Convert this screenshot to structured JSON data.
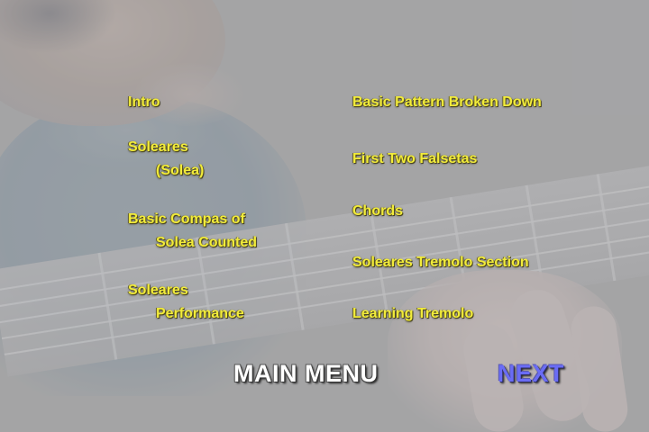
{
  "menu": {
    "left": [
      {
        "lines": [
          "Intro"
        ]
      },
      {
        "lines": [
          "Soleares",
          "(Solea)"
        ]
      },
      {
        "lines": [
          "Basic Compas of",
          "Solea Counted"
        ]
      },
      {
        "lines": [
          "Soleares",
          "Performance"
        ]
      }
    ],
    "right": [
      {
        "lines": [
          "Basic Pattern Broken Down"
        ]
      },
      {
        "lines": [
          "First Two Falsetas"
        ]
      },
      {
        "lines": [
          "Chords"
        ]
      },
      {
        "lines": [
          "Soleares Tremolo Section"
        ]
      },
      {
        "lines": [
          "Learning Tremolo"
        ]
      }
    ]
  },
  "nav": {
    "main_menu_label": "MAIN MENU",
    "next_label": "NEXT"
  },
  "colors": {
    "menu_text": "#f2ec3a",
    "main_menu_text": "#ffffff",
    "next_text": "#6a6cf5",
    "background": "#a3a3a5"
  }
}
